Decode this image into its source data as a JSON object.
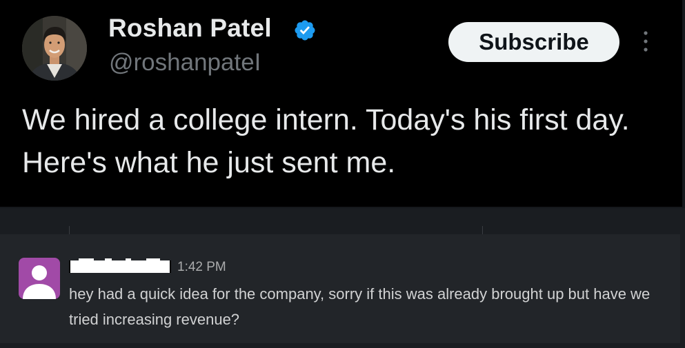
{
  "tweet": {
    "author": {
      "display_name": "Roshan Patel",
      "handle": "@roshanpateI",
      "avatar_icon": "profile-photo",
      "verified_icon": "verified-badge-icon",
      "verified_color": "#1d9bf0"
    },
    "subscribe_label": "Subscribe",
    "more_icon": "more-vertical-icon",
    "text": "We hired a college intern. Today's his first day. Here's what he just sent me."
  },
  "message": {
    "avatar_icon": "default-user-avatar-icon",
    "avatar_color": "#a14aa7",
    "sender_redacted": true,
    "time": "1:42 PM",
    "text": "hey had a quick idea for the company, sorry if this was already brought up but have we tried increasing revenue?"
  }
}
